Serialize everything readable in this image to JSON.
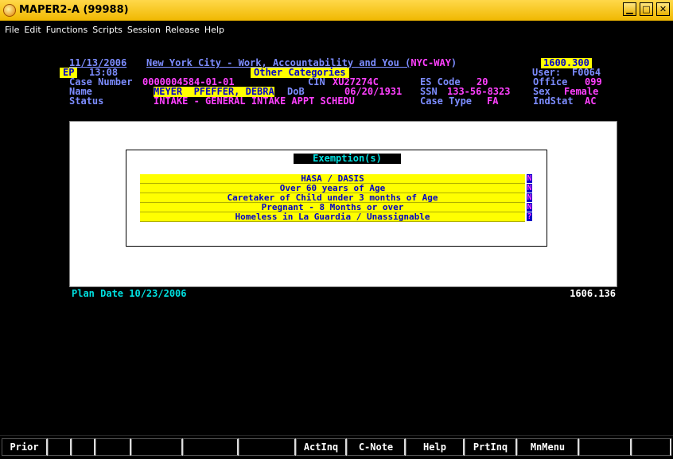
{
  "window": {
    "title": "MAPER2-A (99988)",
    "controls": [
      "minimize",
      "maximize",
      "close"
    ]
  },
  "menu": [
    "File",
    "Edit",
    "Functions",
    "Scripts",
    "Session",
    "Release",
    "Help"
  ],
  "header": {
    "date": "11/13/2006",
    "system_title_prefix": "New York City - Work, Accountability and You (",
    "system_title_code": "NYC-WAY",
    "system_title_suffix": ")",
    "version": "1600.300",
    "ep_label": "EP",
    "time": "13:08",
    "other_categories": "Other Categories",
    "user_label": "User:",
    "user_value": "F0064",
    "case_number_label": "Case Number",
    "case_number_value": "0000004584-01-01",
    "cin_label": "CIN",
    "cin_value": "XU27274C",
    "es_code_label": "ES Code",
    "es_code_value": "20",
    "office_label": "Office",
    "office_value": "099",
    "name_label": "Name",
    "name_value": "MEYER  PFEFFER, DEBRA",
    "dob_label": "DoB",
    "dob_value": "06/20/1931",
    "ssn_label": "SSN",
    "ssn_value": "133-56-8323",
    "sex_label": "Sex",
    "sex_value": "Female",
    "status_label": "Status",
    "status_value": "INTAKE - GENERAL INTAKE APPT SCHEDU",
    "case_type_label": "Case Type",
    "case_type_value": "FA",
    "indstat_label": "IndStat",
    "indstat_value": "AC"
  },
  "exemptions": {
    "title": "Exemption(s)",
    "rows": [
      {
        "label": "HASA / DASIS",
        "value": "N"
      },
      {
        "label": "Over 60 years of Age",
        "value": "N"
      },
      {
        "label": "Caretaker of Child under 3 months of Age",
        "value": "N"
      },
      {
        "label": "Pregnant - 8 Months or over",
        "value": "N"
      },
      {
        "label": "Homeless in La Guardia / Unassignable",
        "value": "?"
      }
    ]
  },
  "footer": {
    "plan_date": "Plan Date 10/23/2006",
    "screen_id": "1606.136"
  },
  "function_keys": [
    "Prior",
    "",
    "",
    "",
    "",
    "",
    "",
    "ActInq",
    "C-Note",
    "Help",
    "PrtInq",
    "MnMenu",
    "",
    "",
    ""
  ]
}
